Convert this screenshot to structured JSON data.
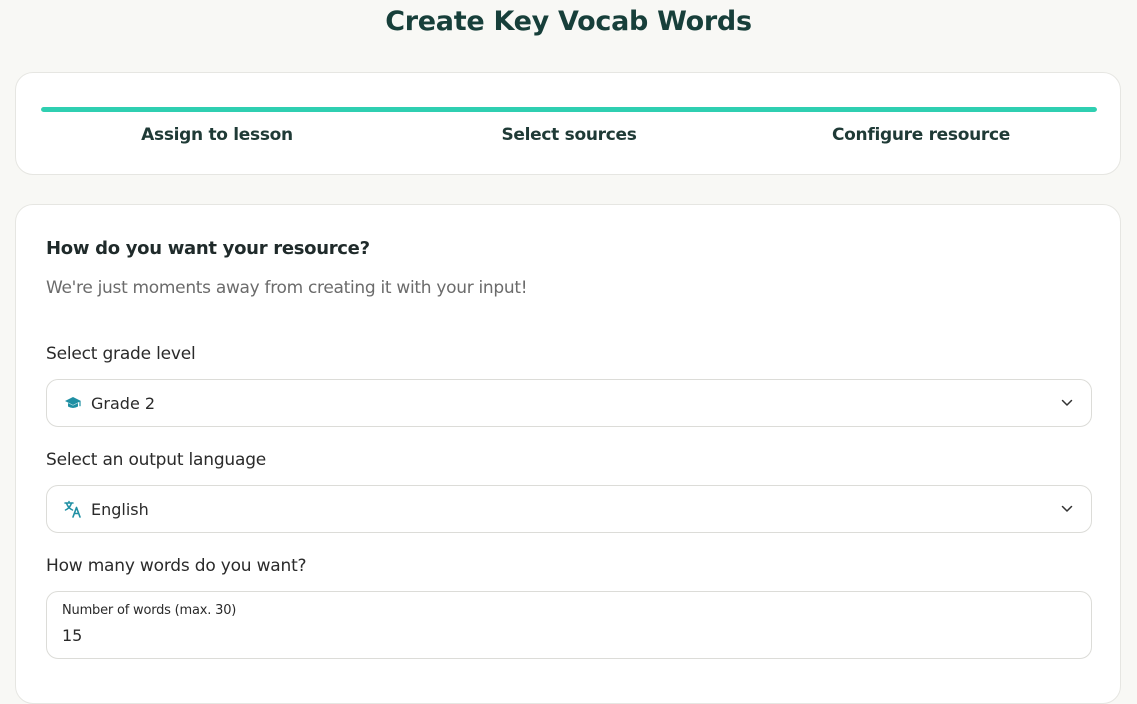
{
  "page": {
    "title": "Create Key Vocab Words"
  },
  "stepper": {
    "progress": 1.0,
    "steps": [
      {
        "label": "Assign to lesson"
      },
      {
        "label": "Select sources"
      },
      {
        "label": "Configure resource"
      }
    ]
  },
  "form": {
    "heading": "How do you want your resource?",
    "subheading": "We're just moments away from creating it with your input!",
    "grade": {
      "label": "Select grade level",
      "value": "Grade 2",
      "icon": "graduation-cap-icon"
    },
    "language": {
      "label": "Select an output language",
      "value": "English",
      "icon": "translate-icon"
    },
    "word_count": {
      "question": "How many words do you want?",
      "field_label": "Number of words (max. 30)",
      "value": "15"
    }
  },
  "colors": {
    "accent": "#2fcfb1",
    "title": "#173f3a",
    "icon": "#1f8fa3"
  }
}
